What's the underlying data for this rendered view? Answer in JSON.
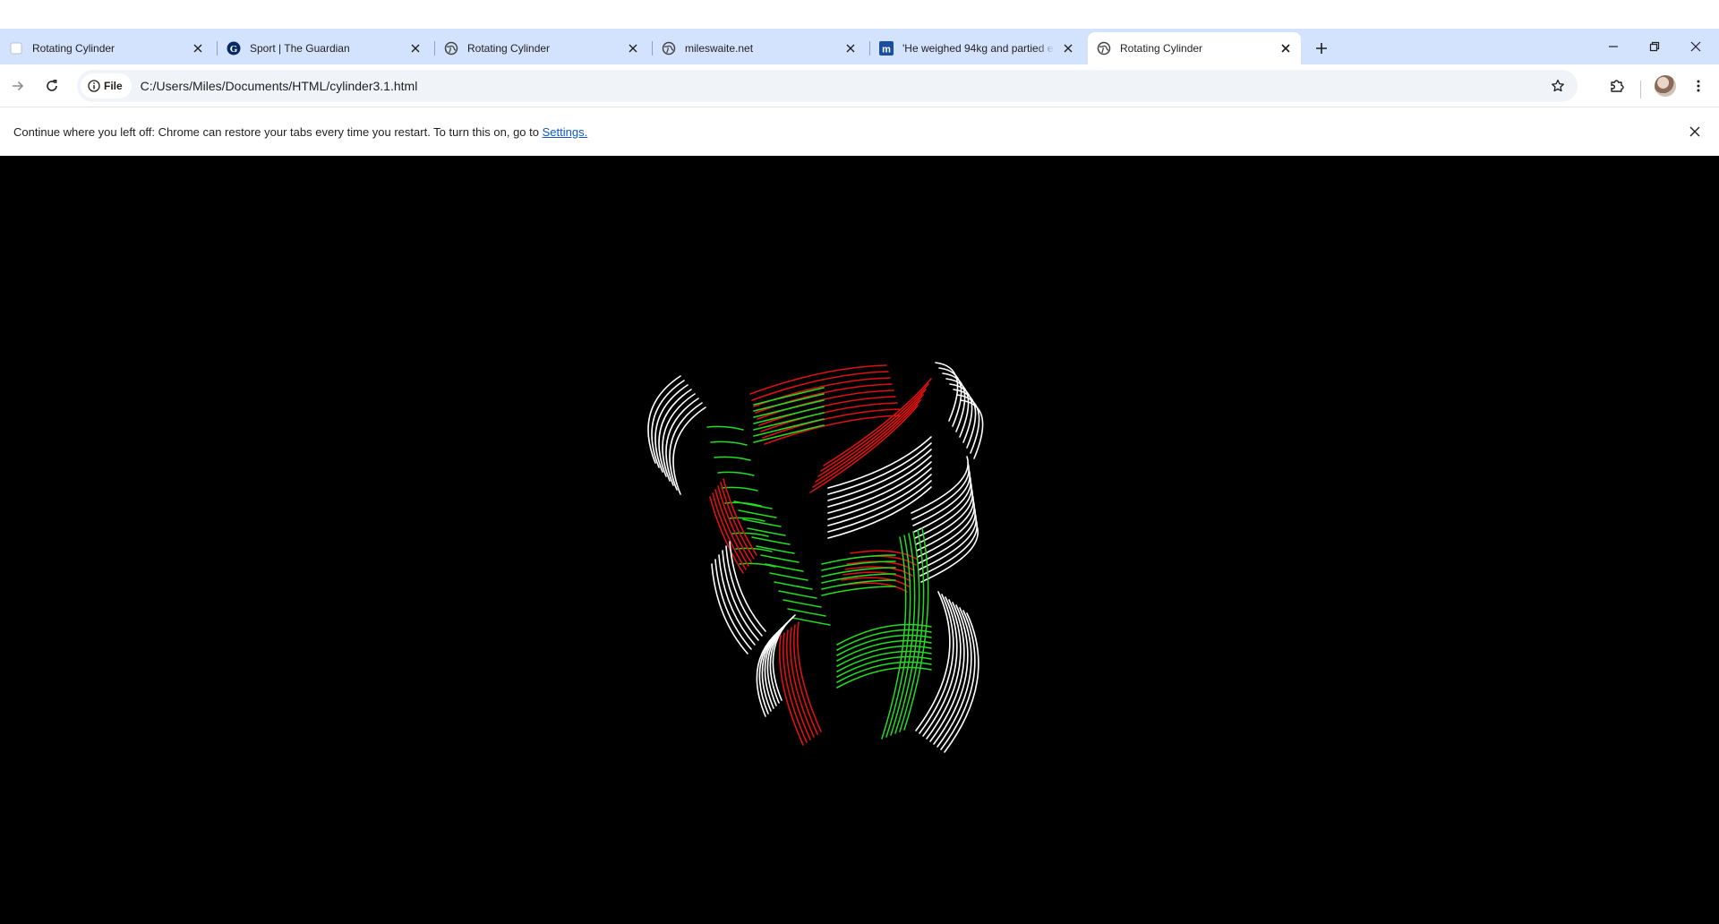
{
  "browser": {
    "tabs": [
      {
        "title": "Rotating Cylinder",
        "favicon": "page-icon",
        "active": false
      },
      {
        "title": "Sport | The Guardian",
        "favicon": "guardian-icon",
        "active": false
      },
      {
        "title": "Rotating Cylinder",
        "favicon": "globe-icon",
        "active": false
      },
      {
        "title": "mileswaite.net",
        "favicon": "globe-icon",
        "active": false
      },
      {
        "title": "'He weighed 94kg and partied e",
        "favicon": "news-m-icon",
        "active": false
      },
      {
        "title": "Rotating Cylinder",
        "favicon": "globe-icon",
        "active": true
      }
    ],
    "toolbar": {
      "chip_label": "File",
      "url": "C:/Users/Miles/Documents/HTML/cylinder3.1.html"
    },
    "infobar": {
      "message": "Continue where you left off: Chrome can restore your tabs every time you restart. To turn this on, go to",
      "link": "Settings."
    }
  },
  "page": {
    "scene": {
      "background": "#000000",
      "colors": {
        "white": "#ffffff",
        "green": "#22dd22",
        "red": "#dd1111"
      }
    }
  },
  "colors": {
    "tabstrip": "#d3e3fd",
    "omnibox": "#f0f3f8",
    "link": "#0b57d0"
  }
}
